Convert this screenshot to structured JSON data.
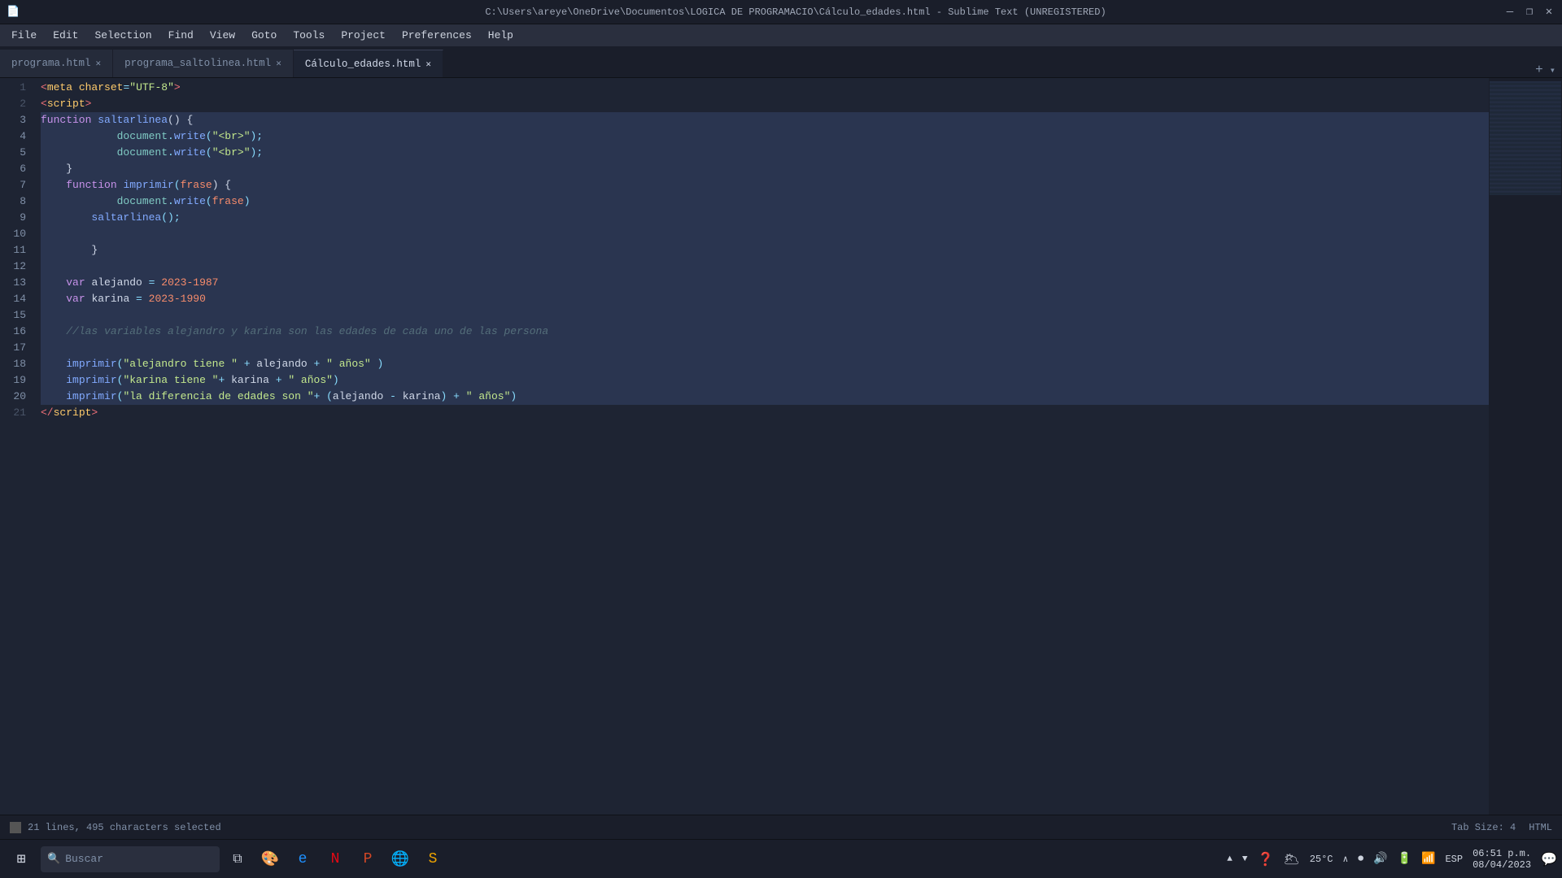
{
  "titleBar": {
    "text": "C:\\Users\\areye\\OneDrive\\Documentos\\LOGICA DE PROGRAMACIO\\Cálculo_edades.html - Sublime Text (UNREGISTERED)",
    "minimize": "—",
    "maximize": "❐",
    "close": "✕"
  },
  "menu": {
    "items": [
      "File",
      "Edit",
      "Selection",
      "Find",
      "View",
      "Goto",
      "Tools",
      "Project",
      "Preferences",
      "Help"
    ]
  },
  "tabs": [
    {
      "label": "programa.html",
      "active": false
    },
    {
      "label": "programa_saltolinea.html",
      "active": false
    },
    {
      "label": "Cálculo_edades.html",
      "active": true
    }
  ],
  "lines": [
    {
      "num": 1,
      "selected": false,
      "tokens": [
        {
          "t": "<",
          "c": "tag"
        },
        {
          "t": "meta",
          "c": "attr"
        },
        {
          "t": " charset",
          "c": "attr"
        },
        {
          "t": "=",
          "c": "punc"
        },
        {
          "t": "\"UTF-8\"",
          "c": "str"
        },
        {
          "t": ">",
          "c": "tag"
        }
      ]
    },
    {
      "num": 2,
      "selected": false,
      "tokens": [
        {
          "t": "<",
          "c": "tag"
        },
        {
          "t": "script",
          "c": "attr"
        },
        {
          "t": ">",
          "c": "tag"
        }
      ]
    },
    {
      "num": 3,
      "selected": true,
      "tokens": [
        {
          "t": "function ",
          "c": "kw"
        },
        {
          "t": "saltarlinea",
          "c": "fn"
        },
        {
          "t": "() {",
          "c": "plain"
        }
      ]
    },
    {
      "num": 4,
      "selected": true,
      "tokens": [
        {
          "t": "            ",
          "c": "plain"
        },
        {
          "t": "document",
          "c": "obj"
        },
        {
          "t": ".",
          "c": "punc"
        },
        {
          "t": "write",
          "c": "meth"
        },
        {
          "t": "(",
          "c": "punc"
        },
        {
          "t": "\"<br>\"",
          "c": "str"
        },
        {
          "t": ");",
          "c": "punc"
        }
      ]
    },
    {
      "num": 5,
      "selected": true,
      "tokens": [
        {
          "t": "            ",
          "c": "plain"
        },
        {
          "t": "document",
          "c": "obj"
        },
        {
          "t": ".",
          "c": "punc"
        },
        {
          "t": "write",
          "c": "meth"
        },
        {
          "t": "(",
          "c": "punc"
        },
        {
          "t": "\"<br>\"",
          "c": "str"
        },
        {
          "t": ");",
          "c": "punc"
        }
      ]
    },
    {
      "num": 6,
      "selected": true,
      "tokens": [
        {
          "t": "    }",
          "c": "plain"
        }
      ]
    },
    {
      "num": 7,
      "selected": true,
      "tokens": [
        {
          "t": "    ",
          "c": "plain"
        },
        {
          "t": "function ",
          "c": "kw"
        },
        {
          "t": "imprimir",
          "c": "fn"
        },
        {
          "t": "(",
          "c": "punc"
        },
        {
          "t": "frase",
          "c": "param"
        },
        {
          "t": ") {",
          "c": "plain"
        }
      ]
    },
    {
      "num": 8,
      "selected": true,
      "tokens": [
        {
          "t": "            ",
          "c": "plain"
        },
        {
          "t": "document",
          "c": "obj"
        },
        {
          "t": ".",
          "c": "punc"
        },
        {
          "t": "write",
          "c": "meth"
        },
        {
          "t": "(",
          "c": "punc"
        },
        {
          "t": "frase",
          "c": "param"
        },
        {
          "t": ")",
          "c": "punc"
        }
      ]
    },
    {
      "num": 9,
      "selected": true,
      "tokens": [
        {
          "t": "        ",
          "c": "plain"
        },
        {
          "t": "saltarlinea",
          "c": "fn"
        },
        {
          "t": "();",
          "c": "punc"
        }
      ]
    },
    {
      "num": 10,
      "selected": true,
      "tokens": [
        {
          "t": "    ",
          "c": "plain"
        }
      ]
    },
    {
      "num": 11,
      "selected": true,
      "tokens": [
        {
          "t": "        }",
          "c": "plain"
        }
      ]
    },
    {
      "num": 12,
      "selected": true,
      "tokens": [
        {
          "t": "    ",
          "c": "plain"
        }
      ]
    },
    {
      "num": 13,
      "selected": true,
      "tokens": [
        {
          "t": "    ",
          "c": "plain"
        },
        {
          "t": "var ",
          "c": "kw"
        },
        {
          "t": "alejando",
          "c": "plain"
        },
        {
          "t": " = ",
          "c": "punc"
        },
        {
          "t": "2023-1987",
          "c": "num"
        }
      ]
    },
    {
      "num": 14,
      "selected": true,
      "tokens": [
        {
          "t": "    ",
          "c": "plain"
        },
        {
          "t": "var ",
          "c": "kw"
        },
        {
          "t": "karina",
          "c": "plain"
        },
        {
          "t": " = ",
          "c": "punc"
        },
        {
          "t": "2023-1990",
          "c": "num"
        }
      ]
    },
    {
      "num": 15,
      "selected": true,
      "tokens": [
        {
          "t": "    ",
          "c": "plain"
        }
      ]
    },
    {
      "num": 16,
      "selected": true,
      "tokens": [
        {
          "t": "    ",
          "c": "plain"
        },
        {
          "t": "//las variables alejandro y karina son las edades de cada uno de las persona",
          "c": "cmt"
        }
      ]
    },
    {
      "num": 17,
      "selected": true,
      "tokens": [
        {
          "t": "    ",
          "c": "plain"
        }
      ]
    },
    {
      "num": 18,
      "selected": true,
      "tokens": [
        {
          "t": "    ",
          "c": "plain"
        },
        {
          "t": "imprimir",
          "c": "fn"
        },
        {
          "t": "(",
          "c": "punc"
        },
        {
          "t": "\"alejandro tiene \"",
          "c": "str"
        },
        {
          "t": " + ",
          "c": "punc"
        },
        {
          "t": "alejando",
          "c": "plain"
        },
        {
          "t": " + ",
          "c": "punc"
        },
        {
          "t": "\" años\"",
          "c": "str"
        },
        {
          "t": " )",
          "c": "punc"
        }
      ]
    },
    {
      "num": 19,
      "selected": true,
      "tokens": [
        {
          "t": "    ",
          "c": "plain"
        },
        {
          "t": "imprimir",
          "c": "fn"
        },
        {
          "t": "(",
          "c": "punc"
        },
        {
          "t": "\"karina tiene \"",
          "c": "str"
        },
        {
          "t": "+ ",
          "c": "punc"
        },
        {
          "t": "karina",
          "c": "plain"
        },
        {
          "t": " + ",
          "c": "punc"
        },
        {
          "t": "\" años\"",
          "c": "str"
        },
        {
          "t": ")",
          "c": "punc"
        }
      ]
    },
    {
      "num": 20,
      "selected": true,
      "tokens": [
        {
          "t": "    ",
          "c": "plain"
        },
        {
          "t": "imprimir",
          "c": "fn"
        },
        {
          "t": "(",
          "c": "punc"
        },
        {
          "t": "\"la diferencia de edades son \"",
          "c": "str"
        },
        {
          "t": "+ (",
          "c": "punc"
        },
        {
          "t": "alejando",
          "c": "plain"
        },
        {
          "t": " - ",
          "c": "punc"
        },
        {
          "t": "karina",
          "c": "plain"
        },
        {
          "t": ") + ",
          "c": "punc"
        },
        {
          "t": "\" años\"",
          "c": "str"
        },
        {
          "t": ")",
          "c": "punc"
        }
      ]
    },
    {
      "num": 21,
      "selected": false,
      "tokens": [
        {
          "t": "</",
          "c": "tag"
        },
        {
          "t": "script",
          "c": "attr"
        },
        {
          "t": ">",
          "c": "tag"
        }
      ]
    }
  ],
  "statusBar": {
    "selectionInfo": "21 lines, 495 characters selected",
    "tabSize": "Tab Size: 4",
    "language": "HTML"
  },
  "taskbar": {
    "searchPlaceholder": "Buscar",
    "temp": "25°C",
    "time": "06:51 p.m.",
    "date": "08/04/2023",
    "lang": "ESP"
  }
}
